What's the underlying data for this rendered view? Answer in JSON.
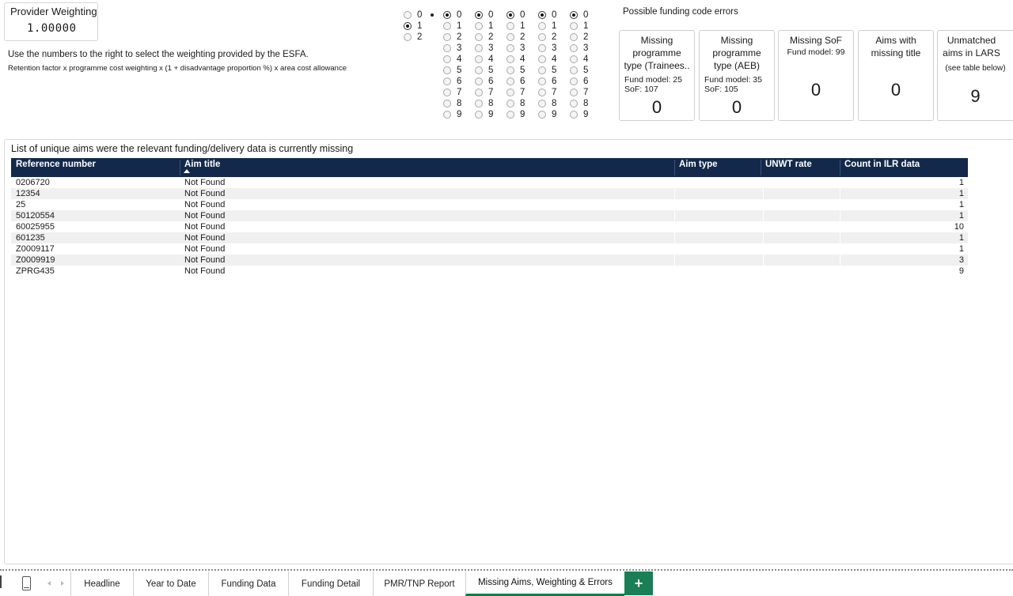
{
  "provider_weighting": {
    "title": "Provider Weighting",
    "value": "1.00000"
  },
  "instructions": {
    "line1": "Use the numbers to the right to select the weighting provided by the ESFA.",
    "line2": "Retention factor x programme cost weighting x (1 + disadvantage proportion %) x area cost allowance"
  },
  "weighting_selector": {
    "columns": [
      {
        "digits": [
          "0",
          "1",
          "2"
        ],
        "selected": "1"
      },
      {
        "digits": [
          "0",
          "1",
          "2",
          "3",
          "4",
          "5",
          "6",
          "7",
          "8",
          "9"
        ],
        "selected": "0"
      },
      {
        "digits": [
          "0",
          "1",
          "2",
          "3",
          "4",
          "5",
          "6",
          "7",
          "8",
          "9"
        ],
        "selected": "0"
      },
      {
        "digits": [
          "0",
          "1",
          "2",
          "3",
          "4",
          "5",
          "6",
          "7",
          "8",
          "9"
        ],
        "selected": "0"
      },
      {
        "digits": [
          "0",
          "1",
          "2",
          "3",
          "4",
          "5",
          "6",
          "7",
          "8",
          "9"
        ],
        "selected": "0"
      },
      {
        "digits": [
          "0",
          "1",
          "2",
          "3",
          "4",
          "5",
          "6",
          "7",
          "8",
          "9"
        ],
        "selected": "0"
      }
    ]
  },
  "funding_errors": {
    "title": "Possible funding code errors",
    "cards": [
      {
        "heading": "Missing programme type (Trainees..",
        "sub1": "Fund model: 25",
        "sub2": "SoF: 107",
        "value": "0"
      },
      {
        "heading": "Missing programme type (AEB)",
        "sub1": "Fund model: 35",
        "sub2": "SoF: 105",
        "value": "0"
      },
      {
        "heading": "Missing SoF",
        "sub1": "Fund model: 99",
        "sub2": "",
        "value": "0"
      },
      {
        "heading": "Aims with missing title",
        "sub1": "",
        "sub2": "",
        "value": "0"
      },
      {
        "heading": "Unmatched aims in LARS",
        "sub1": "(see table below)",
        "sub2": "",
        "value": "9"
      }
    ]
  },
  "missing_aims_table": {
    "title": "List of unique aims were the relevant funding/delivery data is currently missing",
    "headers": {
      "ref": "Reference number",
      "title": "Aim title",
      "type": "Aim type",
      "unwt": "UNWT rate",
      "count": "Count in ILR data"
    },
    "rows": [
      {
        "ref": "0206720",
        "title": "Not Found",
        "type": "",
        "unwt": "",
        "count": "1"
      },
      {
        "ref": "12354",
        "title": "Not Found",
        "type": "",
        "unwt": "",
        "count": "1"
      },
      {
        "ref": "25",
        "title": "Not Found",
        "type": "",
        "unwt": "",
        "count": "1"
      },
      {
        "ref": "50120554",
        "title": "Not Found",
        "type": "",
        "unwt": "",
        "count": "1"
      },
      {
        "ref": "60025955",
        "title": "Not Found",
        "type": "",
        "unwt": "",
        "count": "10"
      },
      {
        "ref": "601235",
        "title": "Not Found",
        "type": "",
        "unwt": "",
        "count": "1"
      },
      {
        "ref": "Z0009117",
        "title": "Not Found",
        "type": "",
        "unwt": "",
        "count": "1"
      },
      {
        "ref": "Z0009919",
        "title": "Not Found",
        "type": "",
        "unwt": "",
        "count": "3"
      },
      {
        "ref": "ZPRG435",
        "title": "Not Found",
        "type": "",
        "unwt": "",
        "count": "9"
      }
    ]
  },
  "sheet_tabs": {
    "tabs": [
      "Headline",
      "Year to Date",
      "Funding Data",
      "Funding Detail",
      "PMR/TNP Report",
      "Missing Aims, Weighting & Errors"
    ],
    "active": "Missing Aims, Weighting & Errors",
    "add_label": "+"
  }
}
